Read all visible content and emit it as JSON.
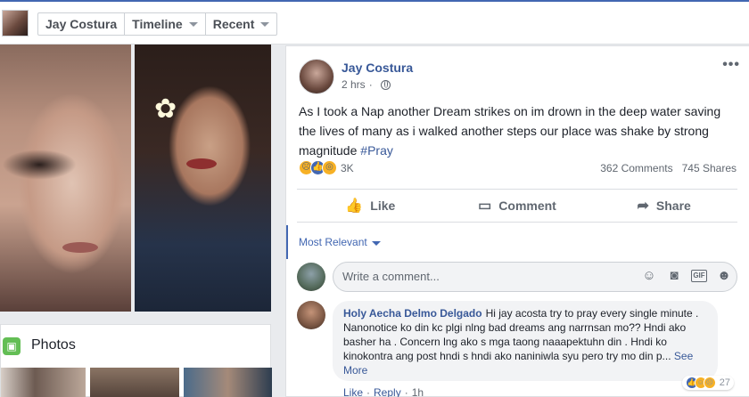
{
  "header": {
    "profile_name": "Jay Costura",
    "timeline_label": "Timeline",
    "recent_label": "Recent"
  },
  "photos_panel": {
    "title": "Photos"
  },
  "post": {
    "author": "Jay Costura",
    "time": "2 hrs",
    "text": "As I took a Nap another Dream strikes on im drown in the deep water saving the lives of many as i walked another steps our place was shake by strong magnitude ",
    "hashtag": "#Pray",
    "reaction_count": "3K",
    "comments_count": "362 Comments",
    "shares_count": "745 Shares",
    "actions": {
      "like": "Like",
      "comment": "Comment",
      "share": "Share"
    }
  },
  "comments_section": {
    "sort_label": "Most Relevant",
    "input_placeholder": "Write a comment...",
    "comment": {
      "author": "Holy Aecha Delmo Delgado",
      "text": "Hi jay acosta try to pray every single minute . Nanonotice ko din kc plgi nlng bad dreams ang narrnsan mo?? Hndi ako basher ha . Concern lng ako s mga taong naaapektuhn din . Hndi ko kinokontra ang post hndi s hndi ako naniniwla syu pero try mo din p...",
      "see_more": "See More",
      "reaction_count": "27",
      "like_label": "Like",
      "reply_label": "Reply",
      "time": "1h"
    }
  },
  "colors": {
    "brand_blue": "#4267b2",
    "link_blue": "#385898",
    "bg": "#e9ebee"
  },
  "icons": [
    "globe-icon",
    "more-options-icon",
    "like-icon",
    "comment-icon",
    "share-icon",
    "emoji-icon",
    "camera-icon",
    "gif-icon",
    "sticker-icon",
    "photos-icon"
  ]
}
